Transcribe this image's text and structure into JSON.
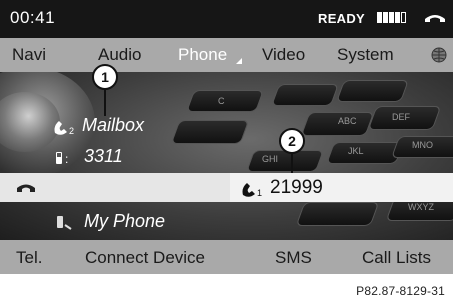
{
  "status": {
    "time": "00:41",
    "ready_label": "READY"
  },
  "top_nav": {
    "items": [
      "Navi",
      "Audio",
      "Phone",
      "Video",
      "System"
    ],
    "active": "Phone"
  },
  "callouts": [
    "1",
    "2"
  ],
  "contacts": {
    "entry1": "Mailbox",
    "entry2": "3311",
    "entry3": "My Phone"
  },
  "active_call": {
    "number": "21999"
  },
  "bottom_nav": {
    "items": [
      "Tel.",
      "Connect Device",
      "SMS",
      "Call Lists"
    ]
  },
  "reference_code": "P82.87-8129-31",
  "keypad_labels": [
    "C",
    "ABC",
    "DEF",
    "GHI",
    "JKL",
    "MNO",
    "WXYZ"
  ],
  "colors": {
    "status_bar": "#161616",
    "nav_bar": "#a9a9a9",
    "call_bar": "#f2f2f2"
  }
}
